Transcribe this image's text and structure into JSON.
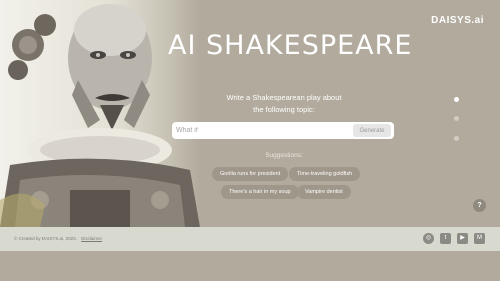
{
  "header": {
    "brand": "DAISYS.ai"
  },
  "hero": {
    "title": "AI SHAKESPEARE",
    "prompt_line1": "Write a Shakespearean play about",
    "prompt_line2": "the following topic:",
    "image_icon": "robot-shakespeare-portrait"
  },
  "search": {
    "placeholder": "What if",
    "value": "",
    "generate_label": "Generate"
  },
  "suggestions": {
    "label": "Suggestions:",
    "items": [
      "Gorilla runs for president",
      "Time-traveling goldfish",
      "There's a hair in my soup",
      "Vampire dentist"
    ]
  },
  "pagination": {
    "active_index": 0,
    "count": 3
  },
  "help": {
    "label": "?"
  },
  "footer": {
    "copyright": "© Created by DAISYS.ai, 2023.",
    "disclaimer_label": "Disclaimer",
    "social_icons": [
      "instagram-icon",
      "twitter-icon",
      "youtube-icon",
      "medium-icon"
    ],
    "social_glyphs": [
      "◎",
      "t",
      "▶",
      "M"
    ]
  },
  "colors": {
    "background": "#b1aa9d",
    "footer": "#d8dad0",
    "chip": "#9e978a",
    "accent_white": "#ffffff"
  }
}
